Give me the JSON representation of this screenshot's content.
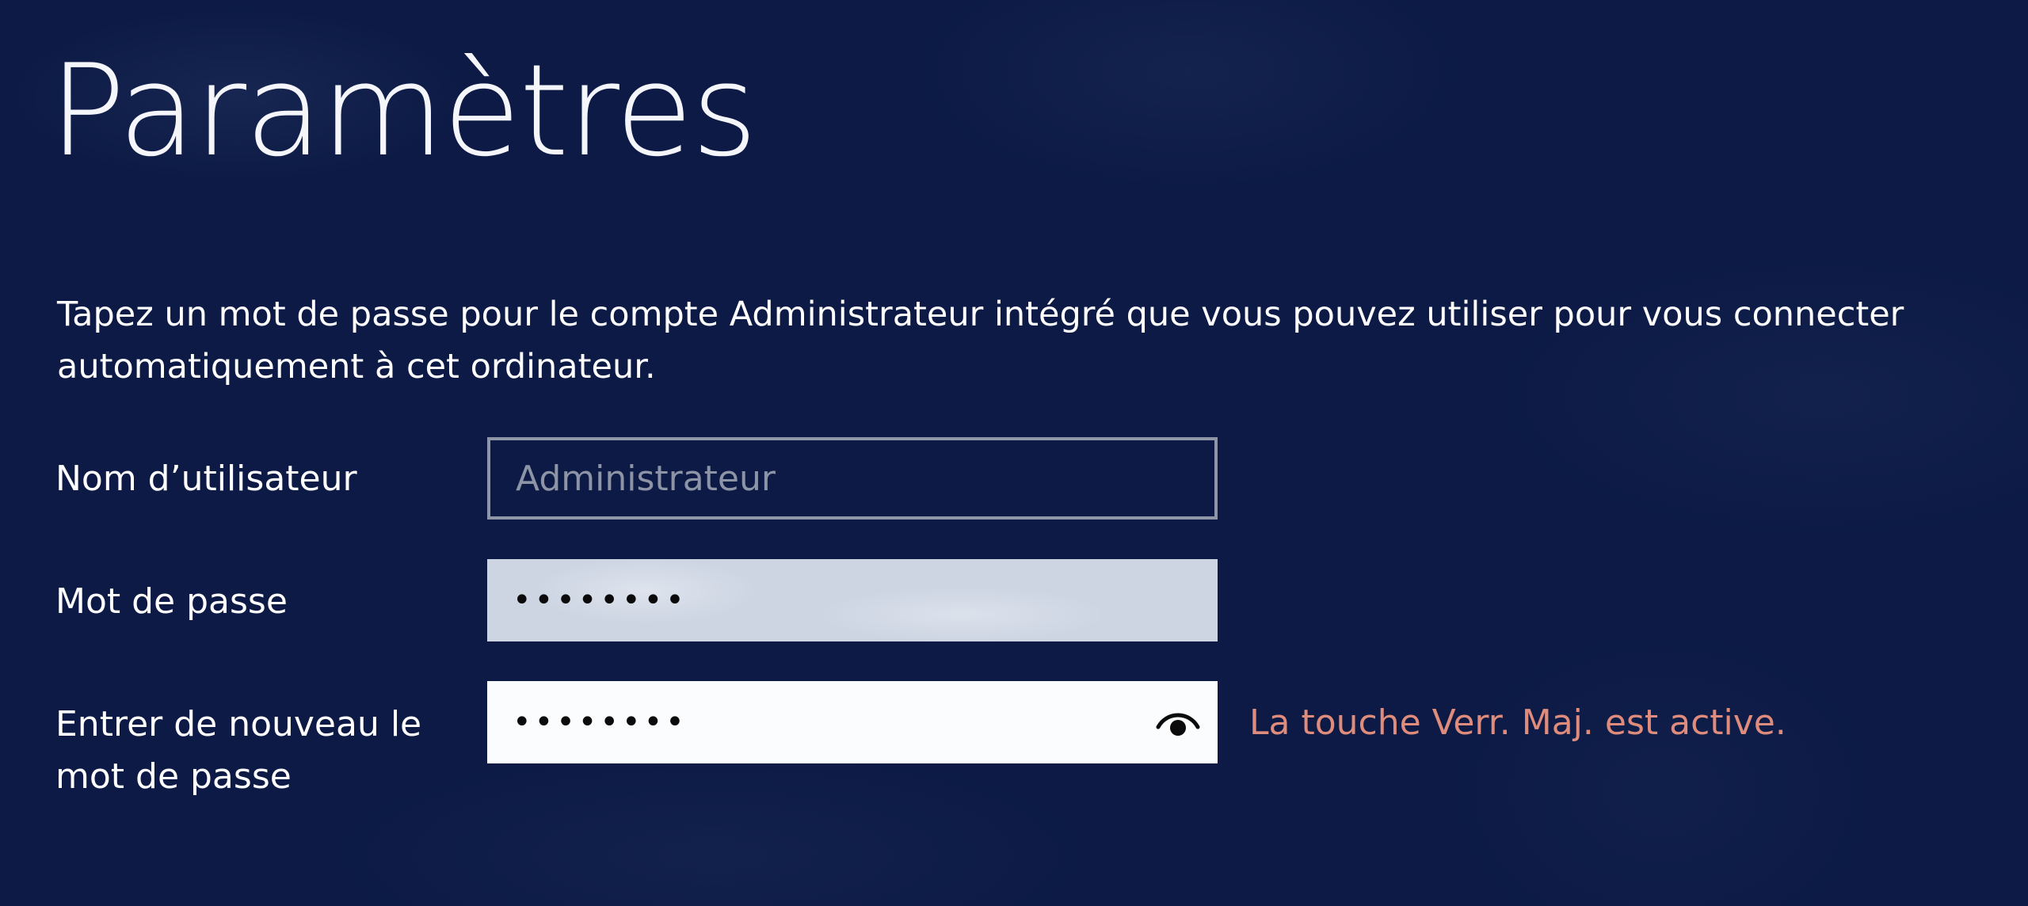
{
  "header": {
    "title": "Paramètres"
  },
  "instruction": "Tapez un mot de passe pour le compte Administrateur intégré que vous pouvez utiliser pour vous connecter automatiquement à cet ordinateur.",
  "form": {
    "username": {
      "label": "Nom d’utilisateur",
      "placeholder": "Administrateur"
    },
    "password": {
      "label": "Mot de passe",
      "masked_value": "••••••••"
    },
    "confirm": {
      "label": "Entrer de nouveau le mot de passe",
      "masked_value": "••••••••",
      "reveal_icon": "eye-icon"
    },
    "caps_lock_warning": "La touche Verr. Maj. est active."
  },
  "colors": {
    "background": "#0c1a45",
    "warning": "#e08c7c",
    "input_border": "#8f96a8"
  }
}
